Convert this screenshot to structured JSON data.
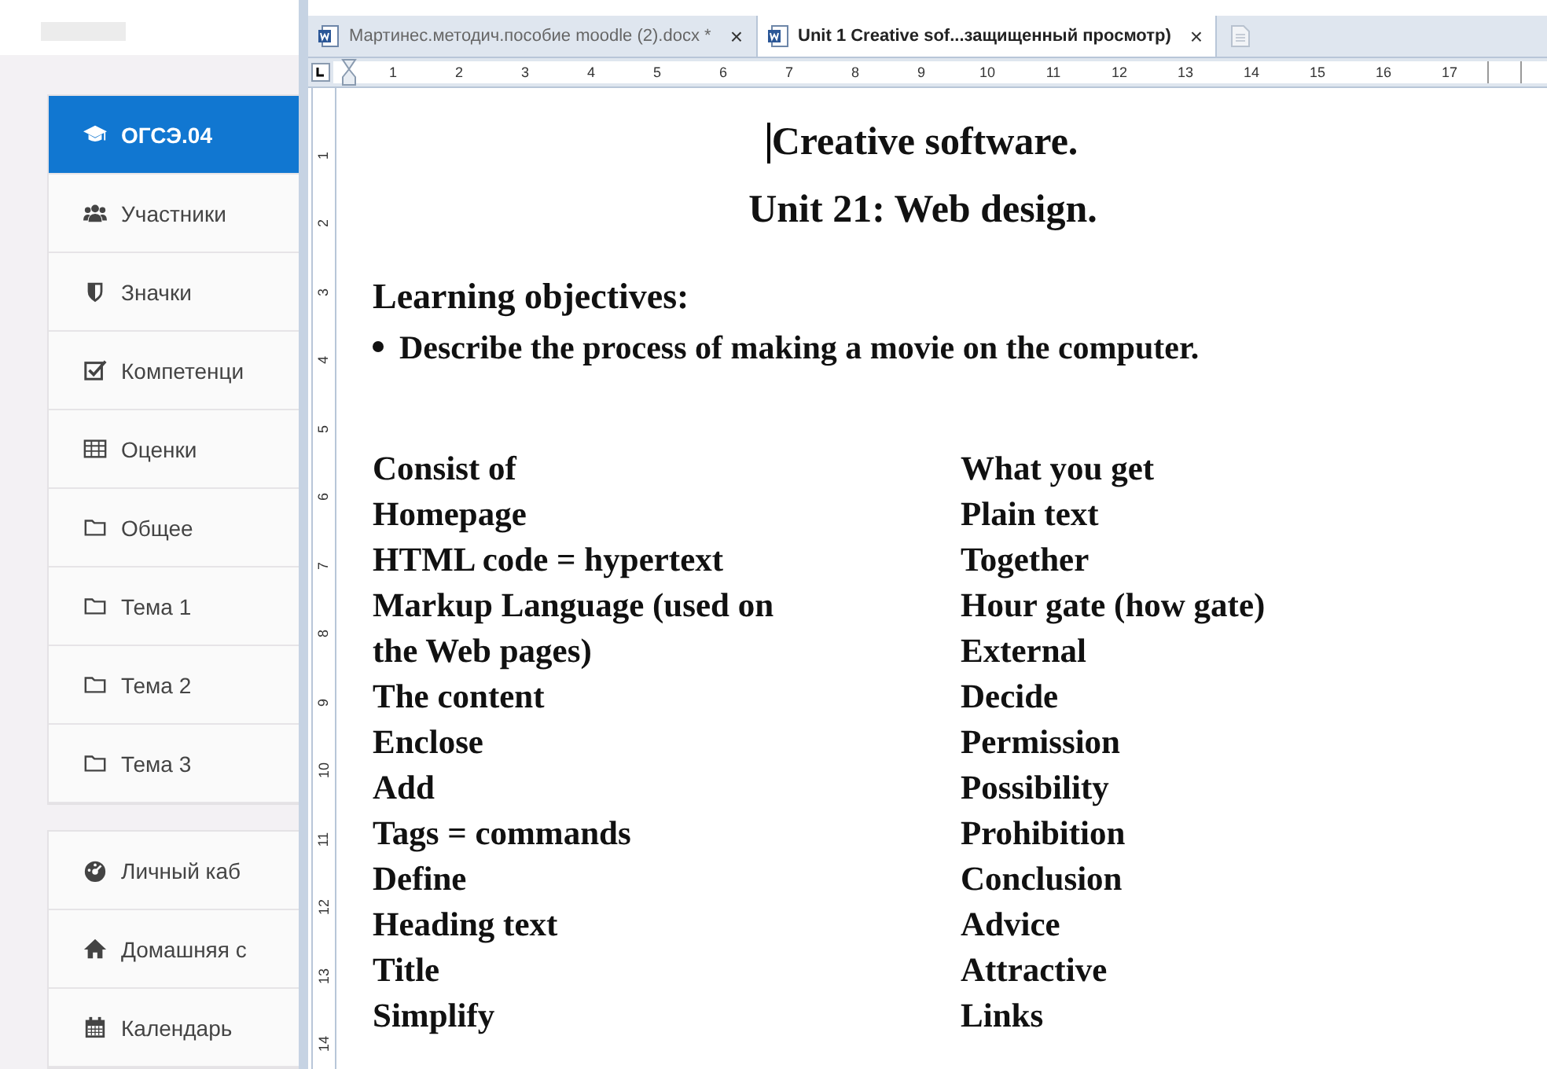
{
  "sidebar": {
    "groups": [
      {
        "items": [
          {
            "label": "ОГСЭ.04",
            "selected": true
          },
          {
            "label": "Участники",
            "selected": false
          },
          {
            "label": "Значки",
            "selected": false
          },
          {
            "label": "Компетенци",
            "selected": false
          },
          {
            "label": "Оценки",
            "selected": false
          },
          {
            "label": "Общее",
            "selected": false
          },
          {
            "label": "Тема 1",
            "selected": false
          },
          {
            "label": "Тема 2",
            "selected": false
          },
          {
            "label": "Тема 3",
            "selected": false
          }
        ]
      },
      {
        "items": [
          {
            "label": "Личный каб",
            "selected": false
          },
          {
            "label": "Домашняя с",
            "selected": false
          },
          {
            "label": "Календарь",
            "selected": false
          }
        ]
      }
    ]
  },
  "word": {
    "tabs": [
      {
        "label": "Мартинес.методич.пособие moodle (2).docx *",
        "close": "×",
        "selected": false
      },
      {
        "label": "Unit 1 Creative sof...защищенный просмотр)",
        "close": "×",
        "selected": true
      }
    ],
    "ruler": {
      "horizontal": [
        "1",
        "2",
        "3",
        "4",
        "5",
        "6",
        "7",
        "8",
        "9",
        "10",
        "11",
        "12",
        "13",
        "14",
        "15",
        "16",
        "17"
      ],
      "vertical": [
        "1",
        "2",
        "3",
        "4",
        "5",
        "6",
        "7",
        "8",
        "9",
        "10",
        "11",
        "12",
        "13",
        "14"
      ]
    },
    "document": {
      "title": [
        "Creative software.",
        "Unit 21: Web design."
      ],
      "heading": "Learning objectives:",
      "bullets": [
        "Describe the process of making a movie on the computer."
      ],
      "rows": [
        [
          "Consist of",
          "What you get"
        ],
        [
          "Homepage",
          "Plain text"
        ],
        [
          "HTML code = hypertext",
          "Together"
        ],
        [
          "Markup Language (used on",
          "Hour gate (how gate)"
        ],
        [
          "the Web pages)",
          "External"
        ],
        [
          "The content",
          "Decide"
        ],
        [
          "Enclose",
          "Permission"
        ],
        [
          "Add",
          "Possibility"
        ],
        [
          "Tags = commands",
          "Prohibition"
        ],
        [
          "Define",
          "Conclusion"
        ],
        [
          "Heading text",
          "Advice"
        ],
        [
          "Title",
          "Attractive"
        ],
        [
          "Simplify",
          "Links"
        ]
      ]
    }
  }
}
